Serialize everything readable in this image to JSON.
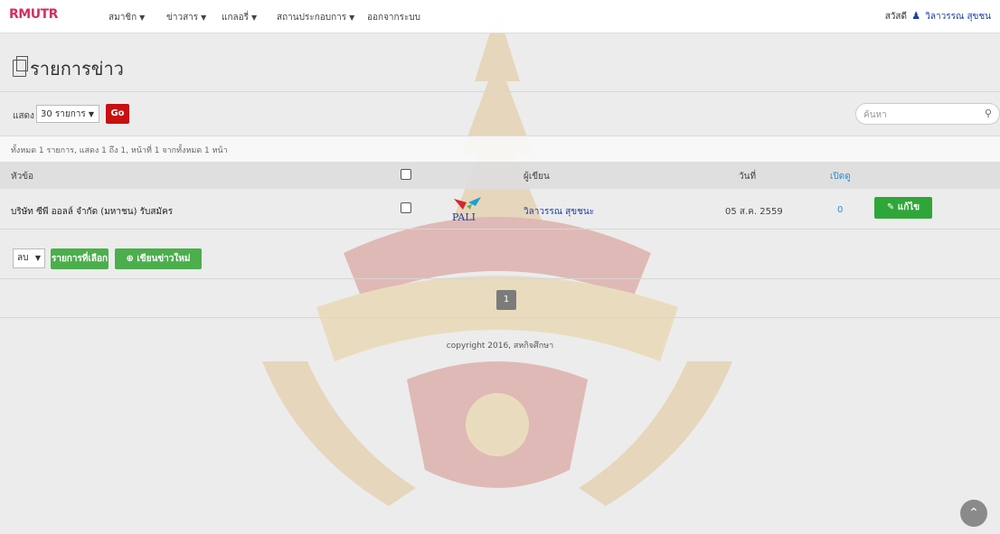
{
  "nav": {
    "logo": "RMUTR",
    "items": [
      {
        "label": "สมาชิก",
        "has_caret": true
      },
      {
        "label": "ข่าวสาร",
        "has_caret": true
      },
      {
        "label": "แกลอรี่",
        "has_caret": true
      },
      {
        "label": "สถานประกอบการ",
        "has_caret": true
      },
      {
        "label": "ออกจากระบบ",
        "has_caret": false
      }
    ],
    "greeting": "สวัสดี",
    "user_icon": "user-icon",
    "user_name": "วิลาวรรณ สุขชน"
  },
  "page": {
    "title": "รายการข่าว",
    "title_icon": "document-icon"
  },
  "toolbar": {
    "show_label": "แสดง",
    "per_page": "30 รายการ",
    "go_label": "Go",
    "search_placeholder": "ค้นหา",
    "search_icon": "search-icon"
  },
  "info": "ทั้งหมด 1 รายการ, แสดง 1 ถึง 1, หน้าที่ 1 จากทั้งหมด 1 หน้า",
  "table": {
    "headers": {
      "title": "หัวข้อ",
      "author": "ผู้เขียน",
      "date": "วันที่",
      "views": "เปิดดู"
    },
    "rows": [
      {
        "title": "บริษัท ซีพี ออลล์ จำกัด (มหาชน) รับสมัคร",
        "logo_text": "PALI",
        "author": "วิลาวรรณ สุขชนะ",
        "date": "05 ส.ค. 2559",
        "views": "0",
        "edit_label": "แก้ไข"
      }
    ]
  },
  "actions": {
    "bulk_action": "ลบ",
    "apply_selected_label": "รายการที่เลือก",
    "new_post_label": "เขียนข่าวใหม่"
  },
  "pagination": {
    "current": "1"
  },
  "footer": "copyright 2016, สหกิจศึกษา",
  "colors": {
    "go_button": "#c81010",
    "green_button": "#4cae4c",
    "edit_button": "#2fa638",
    "link_blue": "#1a3fa6",
    "count_blue": "#2a8fd4",
    "logo": "#d32f5e"
  }
}
